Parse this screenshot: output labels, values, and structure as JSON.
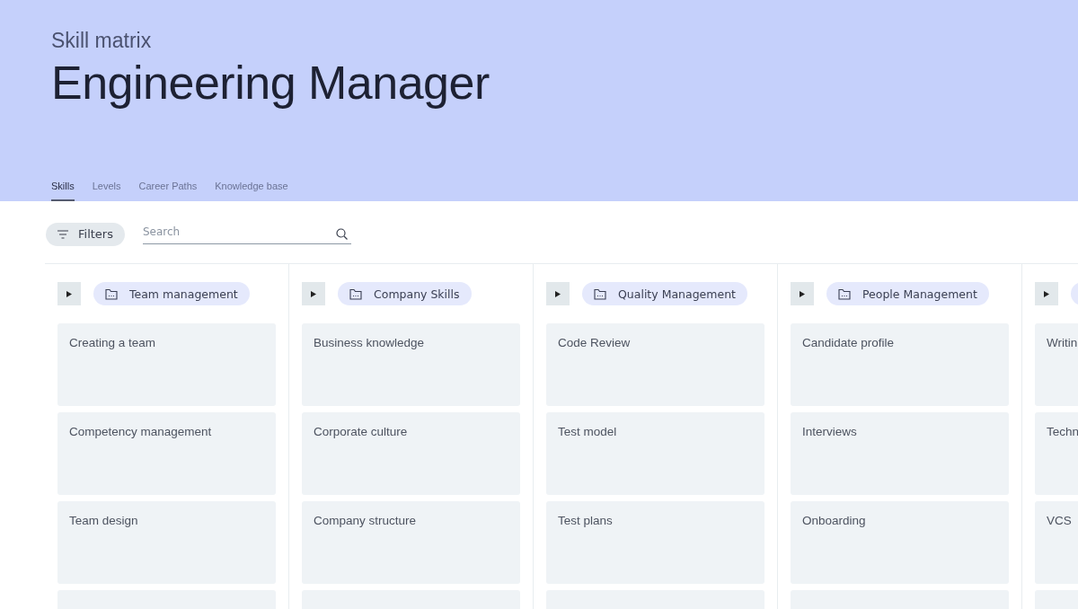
{
  "header": {
    "subtitle": "Skill matrix",
    "title": "Engineering Manager"
  },
  "tabs": [
    {
      "label": "Skills",
      "selected": true
    },
    {
      "label": "Levels",
      "selected": false
    },
    {
      "label": "Career Paths",
      "selected": false
    },
    {
      "label": "Knowledge base",
      "selected": false
    }
  ],
  "toolbar": {
    "filters": "Filters",
    "search": {
      "placeholder": "Search"
    }
  },
  "groups": [
    {
      "name": "Team management",
      "expanded": false,
      "skills": [
        "Creating a team",
        "Competency management",
        "Team design"
      ]
    },
    {
      "name": "Company Skills",
      "expanded": false,
      "skills": [
        "Business knowledge",
        "Corporate culture",
        "Company structure"
      ]
    },
    {
      "name": "Quality Management",
      "expanded": false,
      "skills": [
        "Code Review",
        "Test model",
        "Test plans"
      ]
    },
    {
      "name": "People Management",
      "expanded": false,
      "skills": [
        "Candidate profile",
        "Interviews",
        "Onboarding"
      ]
    },
    {
      "expanded": false,
      "skills": [
        "Writin",
        "Techn",
        "VCS"
      ]
    }
  ]
}
